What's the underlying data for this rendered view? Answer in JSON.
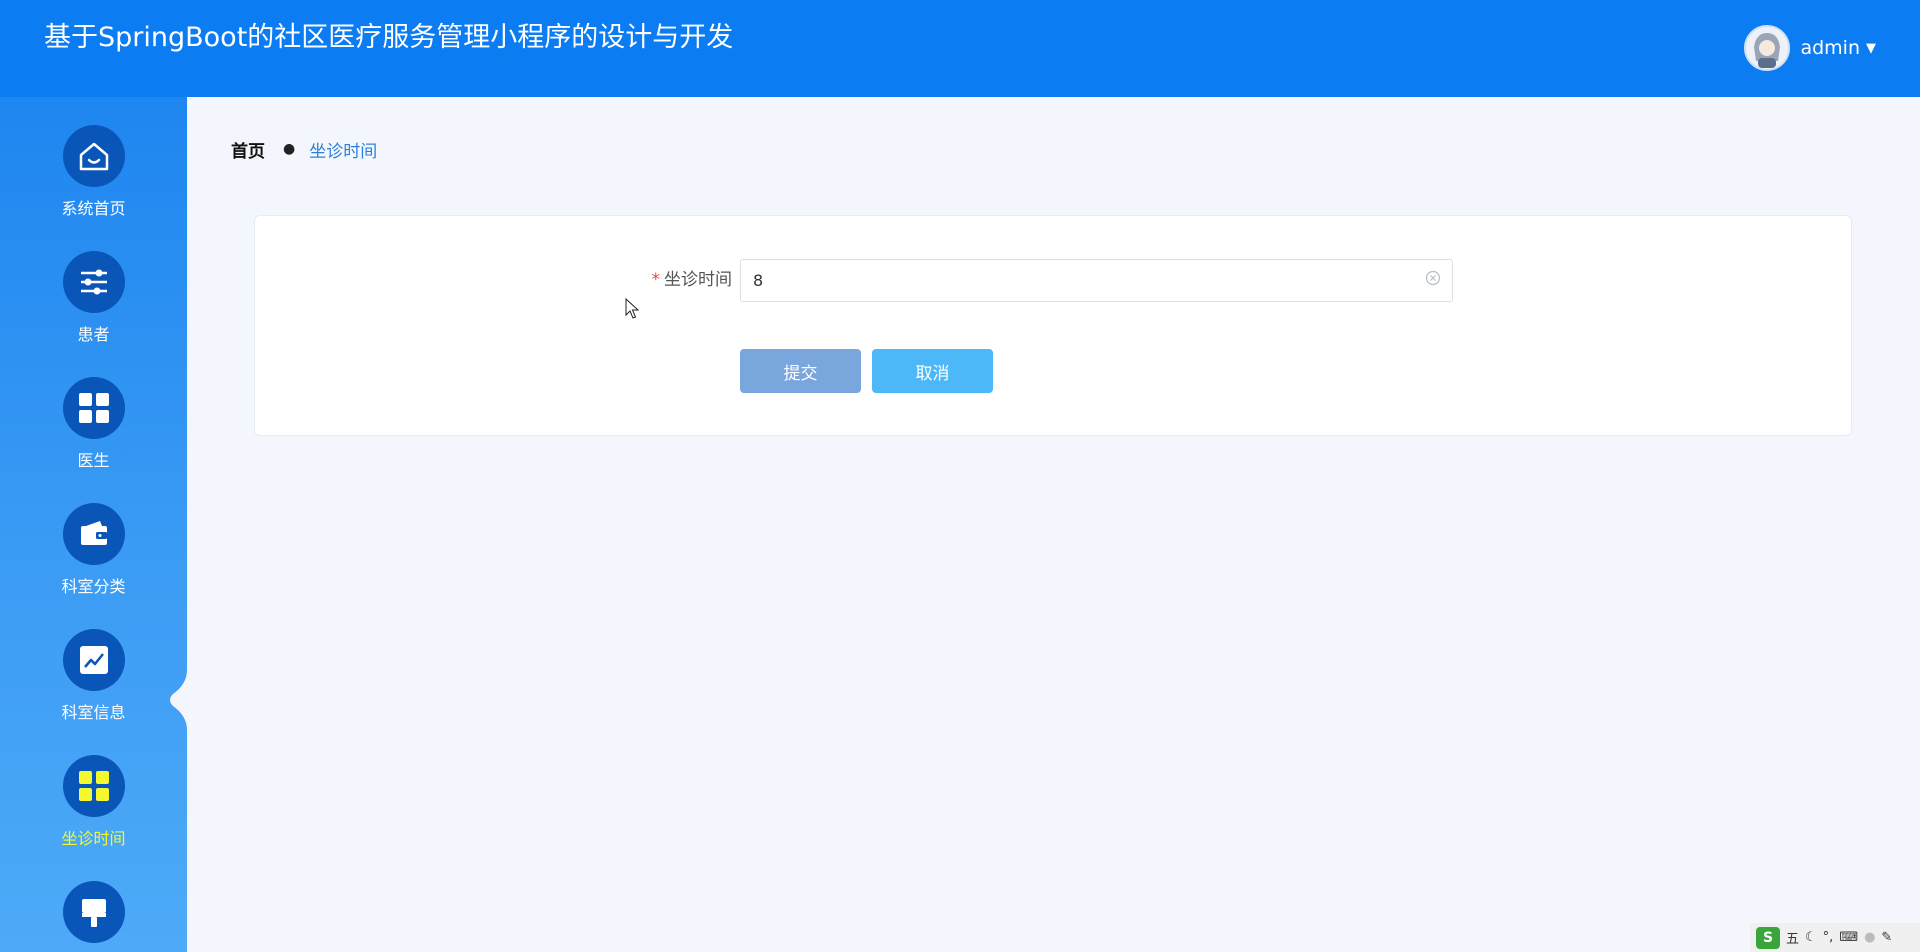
{
  "header": {
    "title": "基于SpringBoot的社区医疗服务管理小程序的设计与开发",
    "username": "admin",
    "background_color": "#0c7cf2"
  },
  "sidebar": {
    "items": [
      {
        "label": "系统首页",
        "icon": "home-icon",
        "active": false
      },
      {
        "label": "患者",
        "icon": "sliders-icon",
        "active": false
      },
      {
        "label": "医生",
        "icon": "grid-icon",
        "active": false
      },
      {
        "label": "科室分类",
        "icon": "wallet-icon",
        "active": false
      },
      {
        "label": "科室信息",
        "icon": "chart-icon",
        "active": false
      },
      {
        "label": "坐诊时间",
        "icon": "grid-icon",
        "active": true
      },
      {
        "label": "",
        "icon": "brush-icon",
        "active": false
      }
    ],
    "active_label_color": "#f4f82d"
  },
  "breadcrumb": {
    "home": "首页",
    "separator": "●",
    "current": "坐诊时间"
  },
  "form": {
    "required_mark": "*",
    "field_label": "坐诊时间",
    "field_value": "8",
    "submit_label": "提交",
    "cancel_label": "取消"
  },
  "tray": {
    "logo": "S",
    "ime_mode": "五",
    "icons": [
      "moon-icon",
      "punctuation-icon",
      "keyboard-icon",
      "user-icon",
      "wrench-icon"
    ]
  }
}
